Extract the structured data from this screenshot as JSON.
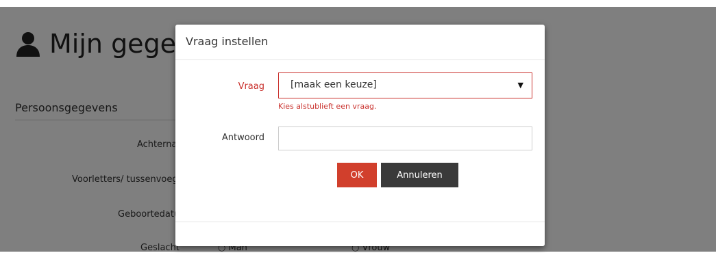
{
  "page": {
    "title": "Mijn gegevens",
    "section_title": "Persoonsgegevens",
    "labels": {
      "achternaam": "Achternaam",
      "voorletters": "Voorletters/ tussenvoegsel",
      "geboortedatum": "Geboortedatum",
      "geslacht": "Geslacht"
    },
    "gender_options": {
      "male": "Man",
      "female": "Vrouw"
    }
  },
  "modal": {
    "title": "Vraag instellen",
    "question_label": "Vraag",
    "question_selected": "[maak een keuze]",
    "question_error": "Kies alstublieft een vraag.",
    "answer_label": "Antwoord",
    "answer_value": "",
    "answer_placeholder": "",
    "ok_label": "OK",
    "cancel_label": "Annuleren"
  },
  "colors": {
    "error": "#c9302c",
    "ok_button": "#d13f2c",
    "cancel_button": "#3a3a3a",
    "overlay": "rgba(0,0,0,0.5)"
  },
  "icons": {
    "title_icon": "user-icon",
    "select_arrow": "caret-down-icon"
  }
}
